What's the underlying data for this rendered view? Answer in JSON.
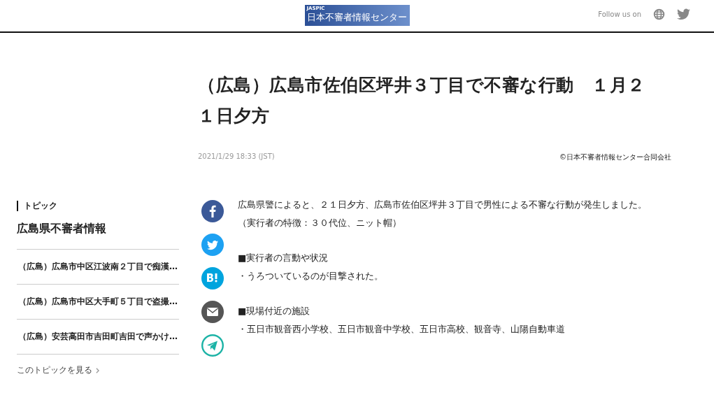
{
  "header": {
    "logo": {
      "small": "JASPIC",
      "name": "日本不審者情報センター"
    },
    "follow_label": "Follow us on",
    "social_links": [
      {
        "kind": "globe"
      },
      {
        "kind": "twitter"
      }
    ]
  },
  "article": {
    "title": "（広島）広島市佐伯区坪井３丁目で不審な行動　１月２１日夕方",
    "date": "2021/1/29 18:33 (JST)",
    "copyright": "©日本不審者情報センター合同会社",
    "share_buttons": [
      {
        "kind": "facebook"
      },
      {
        "kind": "twitter"
      },
      {
        "kind": "hatena"
      },
      {
        "kind": "mail"
      },
      {
        "kind": "telegram"
      }
    ],
    "blocks": [
      [
        "広島県警によると、２１日夕方、広島市佐伯区坪井３丁目で男性による不審な行動が発生しました。",
        "（実行者の特徴：３０代位、ニット帽）"
      ],
      [
        "■実行者の言動や状況",
        "・うろついているのが目撃された。"
      ],
      [
        "■現場付近の施設",
        "・五日市観音西小学校、五日市観音中学校、五日市高校、観音寺、山陽自動車道"
      ]
    ]
  },
  "sidebar": {
    "label": "トピック",
    "title": "広島県不審者情報",
    "items": [
      "（広島）広島市中区江波南２丁目で痴漢…",
      "（広島）広島市中区大手町５丁目で盗撮…",
      "（広島）安芸高田市吉田町吉田で声かけ…"
    ],
    "more_link": "このトピックを見る"
  }
}
